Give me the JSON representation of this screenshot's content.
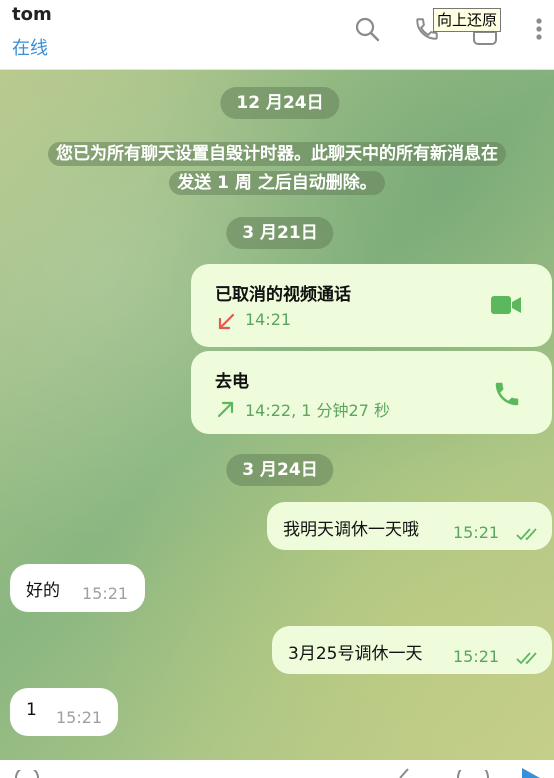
{
  "header": {
    "contact_name": "tom",
    "status": "在线",
    "tooltip": "向上还原"
  },
  "icons": {
    "search": "search-icon",
    "call": "phone-icon",
    "layout": "sidebar-toggle-icon",
    "more": "more-vertical-icon"
  },
  "colors": {
    "accent": "#3a8fd6",
    "outgoing_bubble": "#eefcdc",
    "green": "#5cb85c",
    "missed_red": "#e05a4f"
  },
  "chat": {
    "date1": "12 月24日",
    "service_line1": "您已为所有聊天设置自毁计时器。此聊天中的所有新消息在",
    "service_line2": "发送 1 周 之后自动删除。",
    "date2": "3 月21日",
    "call1_title": "已取消的视频通话",
    "call1_time": "14:21",
    "call2_title": "去电",
    "call2_time": "14:22, 1 分钟27 秒",
    "date3": "3 月24日",
    "msg1_text": "我明天调休一天哦",
    "msg1_time": "15:21",
    "msg2_text": "好的",
    "msg2_time": "15:21",
    "msg3_text": "3月25号调休一天",
    "msg3_time": "15:21",
    "msg4_text": "1",
    "msg4_time": "15:21"
  }
}
